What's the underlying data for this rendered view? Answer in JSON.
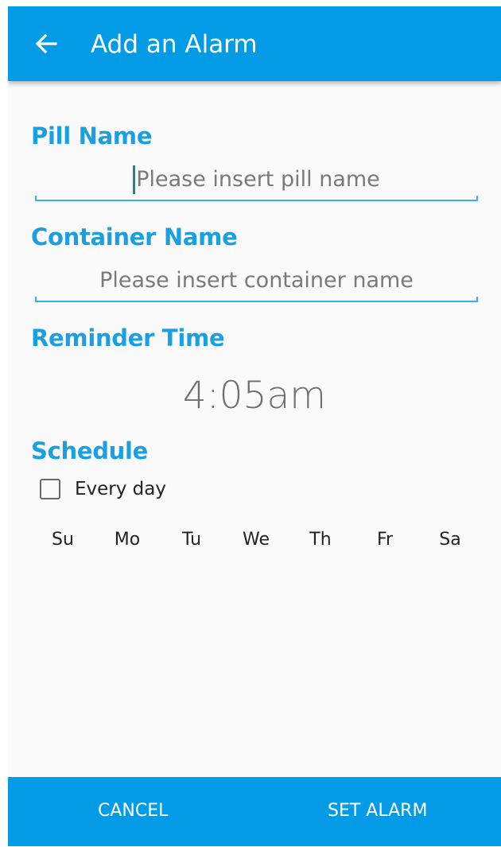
{
  "appbar": {
    "title": "Add an Alarm",
    "back_icon": "arrow-left-icon",
    "background": "#039be5"
  },
  "pill": {
    "label": "Pill Name",
    "placeholder": "Please insert pill name",
    "value": ""
  },
  "container": {
    "label": "Container Name",
    "placeholder": "Please insert container name",
    "value": ""
  },
  "reminder": {
    "label": "Reminder Time",
    "time": "4:05am"
  },
  "schedule": {
    "label": "Schedule",
    "every_day_label": "Every day",
    "every_day_checked": false,
    "days": [
      "Su",
      "Mo",
      "Tu",
      "We",
      "Th",
      "Fr",
      "Sa"
    ]
  },
  "actions": {
    "cancel": "CANCEL",
    "set_alarm": "SET ALARM"
  },
  "colors": {
    "accent": "#039be5",
    "label": "#1a9fe2",
    "caret": "#1e8a7a"
  }
}
